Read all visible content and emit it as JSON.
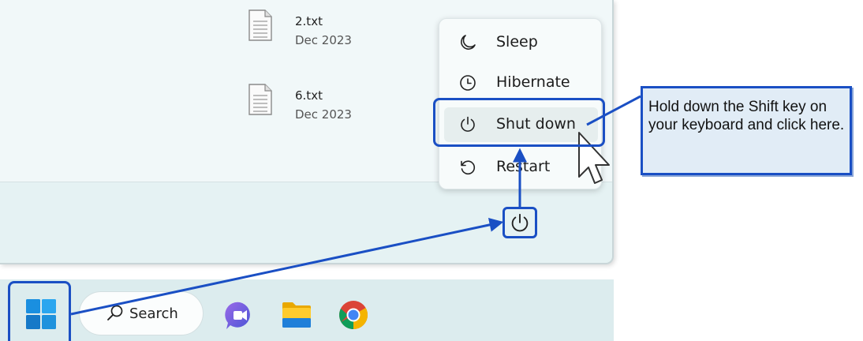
{
  "files": [
    {
      "name": "2.txt",
      "date": "Dec 2023",
      "icon": "text-file-icon"
    },
    {
      "name": "6.txt",
      "date": "Dec 2023",
      "icon": "text-file-icon"
    }
  ],
  "power_menu": {
    "items": [
      {
        "label": "Sleep",
        "icon": "moon-icon"
      },
      {
        "label": "Hibernate",
        "icon": "clock-icon"
      },
      {
        "label": "Shut down",
        "icon": "power-icon"
      },
      {
        "label": "Restart",
        "icon": "restart-icon"
      }
    ]
  },
  "taskbar": {
    "search_label": "Search",
    "apps": [
      "teams-chat-icon",
      "file-explorer-icon",
      "chrome-icon"
    ]
  },
  "callout": {
    "text": "Hold down the Shift key on your keyboard and click here."
  },
  "colors": {
    "annotation_blue": "#1a4fc4",
    "callout_fill": "#e1ecf6",
    "panel_bg": "#e5f2f3"
  }
}
